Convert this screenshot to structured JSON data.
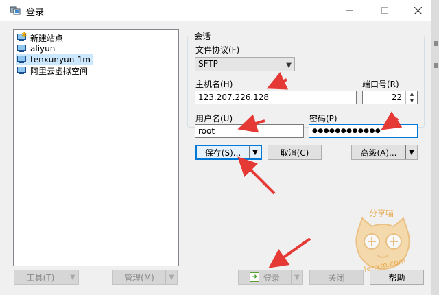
{
  "window": {
    "title": "登录"
  },
  "tree": {
    "items": [
      {
        "label": "新建站点",
        "icon": "new-site-icon",
        "selected": false
      },
      {
        "label": "aliyun",
        "icon": "computer-icon",
        "selected": false
      },
      {
        "label": "tenxunyun-1m",
        "icon": "computer-icon",
        "selected": true
      },
      {
        "label": "阿里云虚拟空间",
        "icon": "computer-icon",
        "selected": false
      }
    ]
  },
  "session": {
    "group_label": "会话",
    "protocol_label": "文件协议(F)",
    "protocol_value": "SFTP",
    "host_label": "主机名(H)",
    "host_value": "123.207.226.128",
    "port_label": "端口号(R)",
    "port_value": "22",
    "user_label": "用户名(U)",
    "user_value": "root",
    "password_label": "密码(P)",
    "password_value": "●●●●●●●●●●●●"
  },
  "buttons": {
    "save": "保存(S)...",
    "cancel": "取消(C)",
    "advanced": "高级(A)...",
    "tools": "工具(T)",
    "manage": "管理(M)",
    "login": "登录",
    "close": "关闭",
    "help": "帮助"
  },
  "watermark": {
    "text": "分享喵",
    "url": "fenxm.com"
  },
  "colors": {
    "accent": "#0078d7",
    "annotation": "#e53935",
    "selection": "#cce8ff"
  }
}
